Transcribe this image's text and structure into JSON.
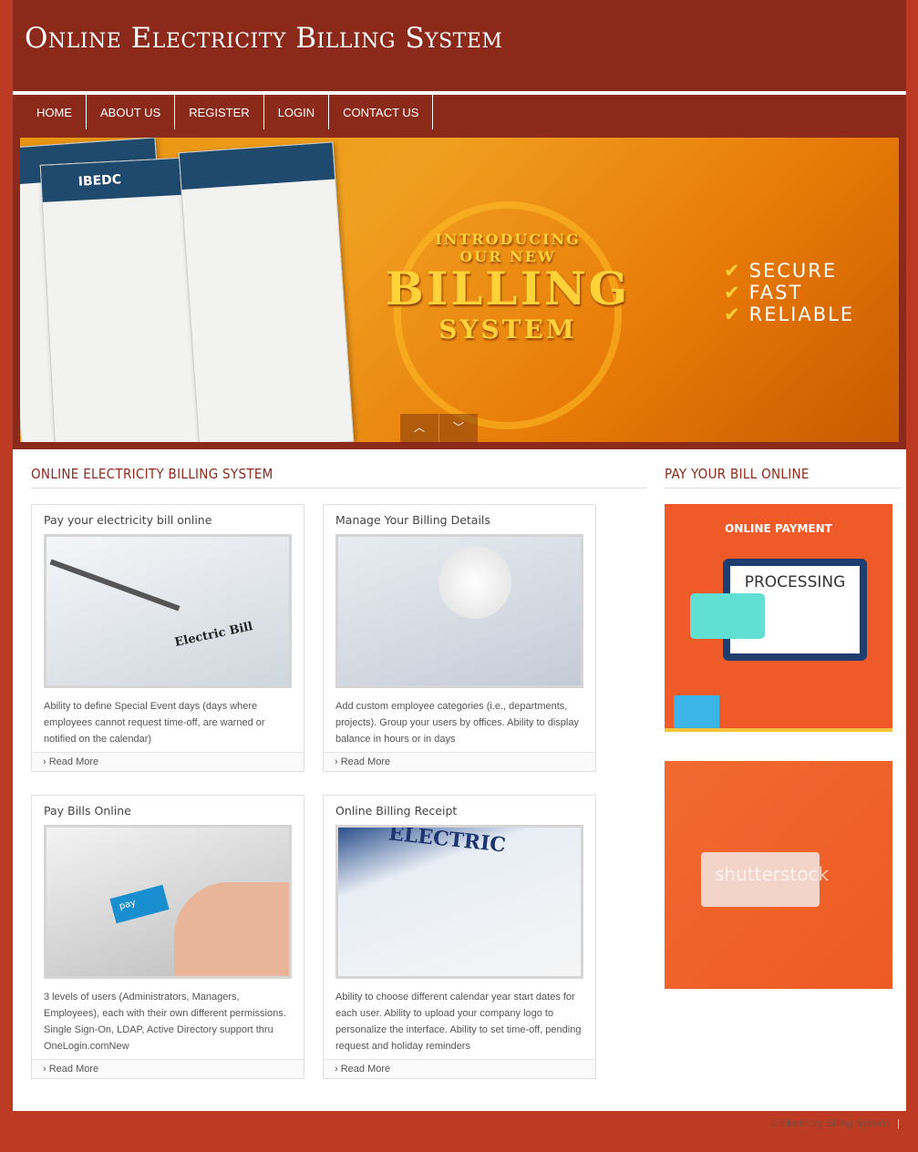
{
  "header": {
    "title": "Online Electricity Billing System"
  },
  "nav": [
    {
      "label": "HOME"
    },
    {
      "label": "ABOUT US"
    },
    {
      "label": "REGISTER"
    },
    {
      "label": "LOGIN"
    },
    {
      "label": "CONTACT US"
    }
  ],
  "banner": {
    "line1": "INTRODUCING",
    "line2": "OUR NEW",
    "line3": "BILLING",
    "line4": "SYSTEM",
    "features": [
      "SECURE",
      "FAST",
      "RELIABLE"
    ],
    "bill_brand": "IBEDC",
    "up_icon": "chevron-up-icon",
    "down_icon": "chevron-down-icon"
  },
  "main": {
    "heading": "ONLINE ELECTRICITY BILLING SYSTEM",
    "cards": [
      {
        "title": "Pay your electricity bill online",
        "text": "Ability to define Special Event days (days where employees cannot request time-off, are warned or notified on the calendar)",
        "more": "Read More",
        "img_caption": "Electric Bill"
      },
      {
        "title": "Manage Your Billing Details",
        "text": "Add custom employee categories (i.e., departments, projects). Group your users by offices. Ability to display balance in hours or in days",
        "more": "Read More"
      },
      {
        "title": "Pay Bills Online",
        "text": "3 levels of users (Administrators, Managers, Employees), each with their own different permissions. Single Sign-On, LDAP, Active Directory support thru OneLogin.comNew",
        "more": "Read More",
        "img_caption": "pay"
      },
      {
        "title": "Online Billing Receipt",
        "text": "Ability to choose different calendar year start dates for each user. Ability to upload your company logo to personalize the interface. Ability to set time-off, pending request and holiday reminders",
        "more": "Read More",
        "img_caption": "ELECTRIC"
      }
    ]
  },
  "sidebar": {
    "heading": "PAY YOUR BILL ONLINE",
    "payment_label": "ONLINE PAYMENT",
    "processing_label": "PROCESSING",
    "watermark": "shutterstock"
  },
  "footer": {
    "text": "© Electricity Billing System"
  },
  "colors": {
    "header": "#8b2a1b",
    "page": "#bd3b22",
    "accent": "#ef5a28"
  }
}
